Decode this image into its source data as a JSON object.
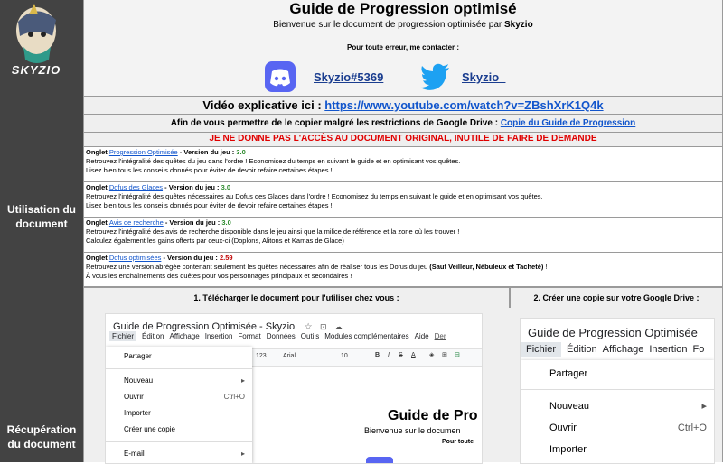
{
  "left": {
    "logo_text": "SKYZIO",
    "section1": "Utilisation du document",
    "section2": "Récupération du document"
  },
  "header": {
    "title": "Guide de Progression optimisé",
    "subtitle_prefix": "Bienvenue sur le document de progression optimisée par ",
    "subtitle_name": "Skyzio",
    "contact": "Pour toute erreur, me contacter :",
    "discord": "Skyzio#5369",
    "twitter": "Skyzio_"
  },
  "video": {
    "label": "Vidéo explicative ici : ",
    "url": "https://www.youtube.com/watch?v=ZBshXrK1Q4k"
  },
  "copy": {
    "text": "Afin de vous permettre de le copier malgré les restrictions de Google Drive : ",
    "link": "Copie du Guide de Progression"
  },
  "warning": "JE NE DONNE PAS L'ACCÈS AU DOCUMENT ORIGINAL, INUTILE DE FAIRE DE DEMANDE",
  "entries": [
    {
      "prefix": "Onglet ",
      "name": "Progression Optimisée",
      "version_label": " - Version du jeu : ",
      "version": "3.0",
      "line1": "Retrouvez l'intégralité des quêtes du jeu dans l'ordre ! Economisez du temps en suivant le guide et en optimisant vos quêtes.",
      "line2": "Lisez bien tous les conseils donnés pour éviter de devoir refaire certaines étapes !"
    },
    {
      "prefix": "Onglet ",
      "name": "Dofus des Glaces",
      "version_label": " - Version du jeu : ",
      "version": "3.0",
      "line1": "Retrouvez l'intégralité des quêtes nécessaires au Dofus des Glaces dans l'ordre ! Economisez du temps en suivant le guide et en optimisant vos quêtes.",
      "line2": "Lisez bien tous les conseils donnés pour éviter de devoir refaire certaines étapes !"
    },
    {
      "prefix": "Onglet ",
      "name": "Avis de recherche",
      "version_label": " - Version du jeu : ",
      "version": "3.0",
      "line1": "Retrouvez l'intégralité des avis de recherche disponible dans le jeu ainsi que la milice de référence et la zone où les trouver !",
      "line2": "Calculez également les gains offerts par ceux-ci (Doplons, Alitons et Kamas de Glace)"
    },
    {
      "prefix": "Onglet ",
      "name": "Dofus optimisées",
      "version_label": " - Version du jeu : ",
      "version": "2.59",
      "line1": "Retrouvez une version abrégée contenant seulement les quêtes nécessaires afin de réaliser tous les Dofus du jeu ",
      "line1_bold": "(Sauf Veilleur, Nébuleux et Tacheté)",
      "line1_end": " !",
      "line2": "À vous les enchaînements des quêtes pour vos personnages principaux et secondaires !"
    }
  ],
  "steps": {
    "step1": "1. Télécharger le document pour l'utiliser chez vous :",
    "step2": "2. Créer une copie sur votre Google Drive :"
  },
  "shot1": {
    "doc_title": "Guide de Progression Optimisée - Skyzio",
    "menu": [
      "Fichier",
      "Édition",
      "Affichage",
      "Insertion",
      "Format",
      "Données",
      "Outils",
      "Modules complémentaires",
      "Aide",
      "Der"
    ],
    "toolbar_zoom": "123",
    "toolbar_font": "Arial",
    "toolbar_size": "10",
    "dropdown": [
      "Partager",
      "Nouveau",
      "Ouvrir",
      "Importer",
      "Créer une copie",
      "E-mail"
    ],
    "shortcut_open": "Ctrl+O",
    "sheet_title": "Guide de Pro",
    "sheet_sub": "Bienvenue sur le documen",
    "sheet_contact": "Pour toute"
  },
  "shot2": {
    "doc_title": "Guide de Progression Optimisée",
    "menu": [
      "Fichier",
      "Édition",
      "Affichage",
      "Insertion",
      "Fo"
    ],
    "dropdown": [
      "Partager",
      "Nouveau",
      "Ouvrir",
      "Importer"
    ],
    "shortcut_open": "Ctrl+O"
  },
  "colors": {
    "sidebar": "#434343",
    "discord": "#5865F2",
    "twitter": "#1DA1F2",
    "link": "#1155cc",
    "warning": "#e00000"
  }
}
